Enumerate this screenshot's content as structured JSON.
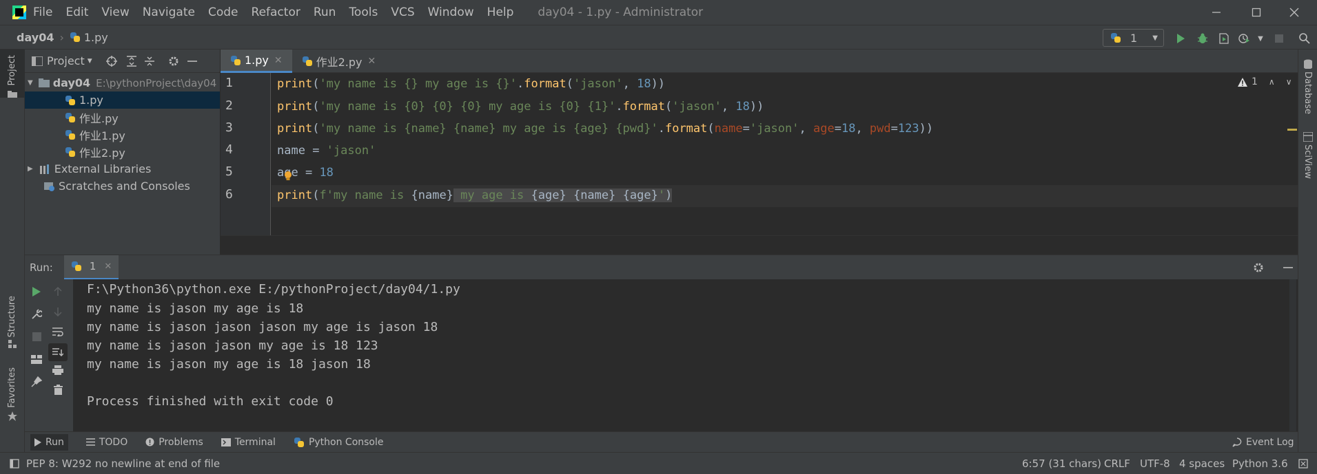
{
  "menu": {
    "items": [
      "File",
      "Edit",
      "View",
      "Navigate",
      "Code",
      "Refactor",
      "Run",
      "Tools",
      "VCS",
      "Window",
      "Help"
    ],
    "window_title": "day04 - 1.py - Administrator"
  },
  "navbar": {
    "project": "day04",
    "file": "1.py",
    "run_config": "1"
  },
  "left_strip": {
    "project_label": "Project",
    "structure_label": "Structure",
    "favorites_label": "Favorites"
  },
  "right_strip": {
    "database_label": "Database",
    "sciview_label": "SciView"
  },
  "project_panel": {
    "title": "Project",
    "root_name": "day04",
    "root_path": "E:\\pythonProject\\day04",
    "files": [
      "1.py",
      "作业.py",
      "作业1.py",
      "作业2.py"
    ],
    "external_libraries": "External Libraries",
    "scratches": "Scratches and Consoles"
  },
  "editor": {
    "tabs": [
      "1.py",
      "作业2.py"
    ],
    "warning_count": "1",
    "line_numbers": [
      "1",
      "2",
      "3",
      "4",
      "5",
      "6"
    ]
  },
  "code": {
    "l1": {
      "fn": "print",
      "open": "(",
      "str": "'my name is {} my age is {}'",
      "dot": ".",
      "fmt": "format",
      "p1": "(",
      "a1": "'jason'",
      "c1": ", ",
      "n1": "18",
      "close": "))"
    },
    "l2": {
      "fn": "print",
      "open": "(",
      "str": "'my name is {0} {0} {0} my age is {0} {1}'",
      "dot": ".",
      "fmt": "format",
      "p1": "(",
      "a1": "'jason'",
      "c1": ", ",
      "n1": "18",
      "close": "))"
    },
    "l3": {
      "fn": "print",
      "open": "(",
      "str": "'my name is {name} {name} my age is {age} {pwd}'",
      "dot": ".",
      "fmt": "format",
      "p1": "(",
      "k1": "name",
      "e1": "=",
      "a1": "'jason'",
      "c1": ", ",
      "k2": "age",
      "e2": "=",
      "n2": "18",
      "c2": ", ",
      "k3": "pwd",
      "e3": "=",
      "n3": "123",
      "close": "))"
    },
    "l4": {
      "name": "name",
      "eq": " = ",
      "val": "'jason'"
    },
    "l5": {
      "name": "age",
      "eq": " = ",
      "val": "18"
    },
    "l6": {
      "fn": "print",
      "open": "(",
      "pre": "f'my name is ",
      "v1": "{name}",
      "mid": " my age is ",
      "v2": "{age}",
      "sp1": " ",
      "v3": "{name}",
      "sp2": " ",
      "v4": "{age}",
      "end": "'",
      "close": ")"
    }
  },
  "run": {
    "label": "Run:",
    "tab": "1",
    "output": [
      "F:\\Python36\\python.exe E:/pythonProject/day04/1.py",
      "my name is jason my age is 18",
      "my name is jason jason jason my age is jason 18",
      "my name is jason jason my age is 18 123",
      "my name is jason my age is 18 jason 18",
      "",
      "Process finished with exit code 0"
    ]
  },
  "tool_tabs": [
    "Run",
    "TODO",
    "Problems",
    "Terminal",
    "Python Console"
  ],
  "event_log": "Event Log",
  "status": {
    "message": "PEP 8: W292 no newline at end of file",
    "position": "6:57 (31 chars)",
    "line_sep": "CRLF",
    "encoding": "UTF-8",
    "indent": "4 spaces",
    "interpreter": "Python 3.6"
  },
  "colors": {
    "accent": "#4a88c7",
    "run_green": "#59a869",
    "bg_editor": "#2b2b2b",
    "bg_panel": "#3c3f41"
  }
}
